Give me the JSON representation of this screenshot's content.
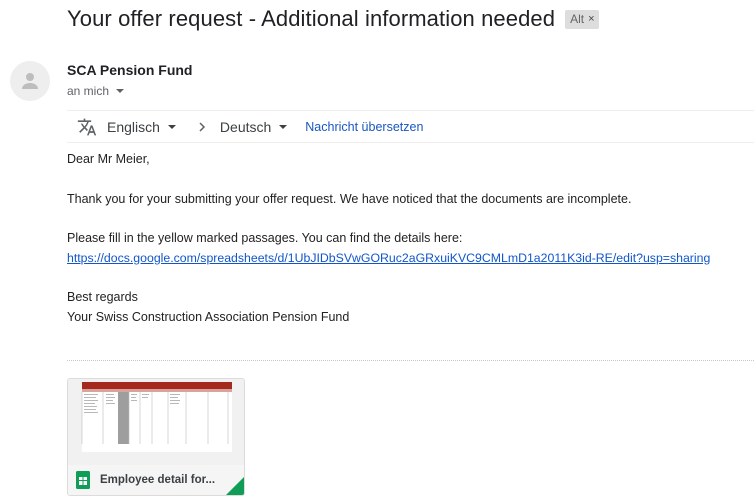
{
  "email": {
    "subject": "Your offer request - Additional information needed",
    "label": "Alt",
    "label_remove": "×",
    "sender": "SCA Pension Fund",
    "recipient": "an mich"
  },
  "translate_bar": {
    "source_language": "Englisch",
    "target_language": "Deutsch",
    "translate_link": "Nachricht übersetzen"
  },
  "body": {
    "greeting": "Dear Mr Meier,",
    "paragraph1": "Thank you for your submitting your offer request. We have noticed that the documents are incomplete.",
    "paragraph2": "Please fill in the yellow marked passages. You can find the details here:",
    "link": "https://docs.google.com/spreadsheets/d/1UbJIDbSVwGORuc2aGRxuiKVC9CMLmD1a2011K3id-RE/edit?usp=sharing",
    "closing": "Best regards",
    "signature": "Your Swiss Construction Association Pension Fund"
  },
  "attachment": {
    "name": "Employee detail for...",
    "icon": "google-sheets-icon",
    "accent_color": "#0f9d58",
    "header_color": "#a52a1e"
  },
  "colors": {
    "link": "#1155cc",
    "label_bg": "#dddddd"
  }
}
